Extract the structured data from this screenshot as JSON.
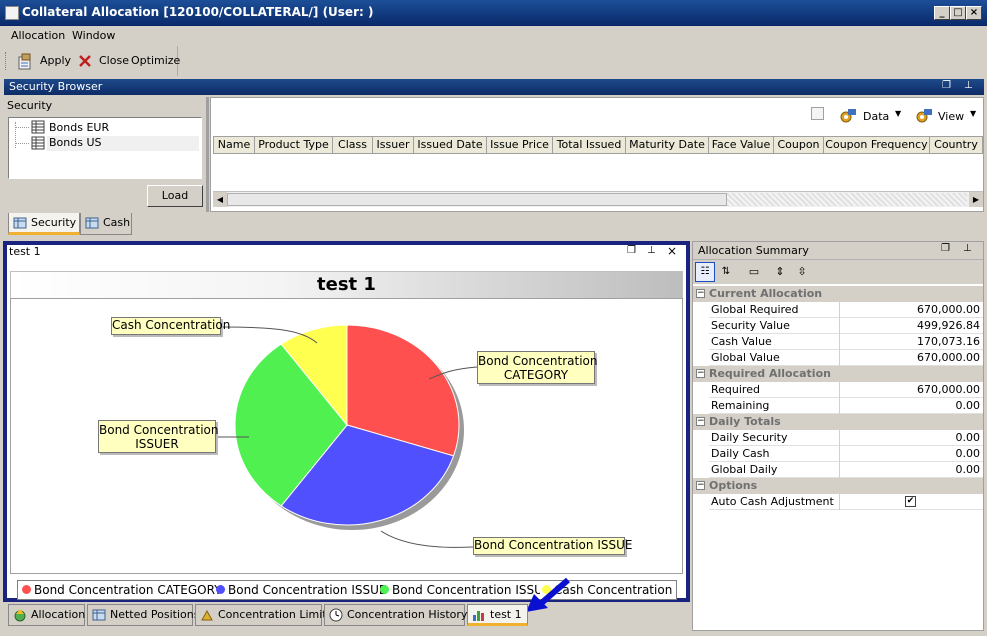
{
  "window": {
    "title": "Collateral Allocation [120100/COLLATERAL/] (User: )"
  },
  "menu": [
    "Allocation",
    "Window"
  ],
  "toolbar": {
    "apply": "Apply",
    "close": "Close",
    "optimize": "Optimize"
  },
  "security_browser": {
    "title": "Security Browser",
    "tree_header": "Security",
    "tree_items": [
      "Bonds EUR",
      "Bonds US"
    ],
    "load_button": "Load",
    "data_menu": "Data",
    "view_menu": "View",
    "columns": [
      "Name",
      "Product Type",
      "Class",
      "Issuer",
      "Issued Date",
      "Issue Price",
      "Total Issued",
      "Maturity Date",
      "Face Value",
      "Coupon",
      "Coupon Frequency",
      "Country"
    ],
    "tabs": [
      "Security",
      "Cash"
    ]
  },
  "chart_panel": {
    "tab_title": "test 1",
    "chart_data": {
      "type": "pie",
      "title": "test 1",
      "series": [
        {
          "name": "Bond Concentration CATEGORY",
          "value": 30,
          "color": "#ff5050"
        },
        {
          "name": "Bond Concentration ISSUE",
          "value": 30,
          "color": "#5050ff"
        },
        {
          "name": "Bond Concentration ISSUER",
          "value": 30,
          "color": "#50f050"
        },
        {
          "name": "Cash Concentration",
          "value": 10,
          "color": "#ffff50"
        }
      ],
      "callouts": {
        "cash": "Cash Concentration",
        "category_l1": "Bond Concentration",
        "category_l2": "CATEGORY",
        "issuer_l1": "Bond Concentration",
        "issuer_l2": "ISSUER",
        "issue": "Bond Concentration ISSUE"
      },
      "legend_placement": "bottom"
    }
  },
  "allocation_summary": {
    "title": "Allocation Summary",
    "sections": [
      {
        "name": "Current Allocation",
        "rows": [
          {
            "label": "Global Required",
            "value": "670,000.00"
          },
          {
            "label": "Security Value",
            "value": "499,926.84"
          },
          {
            "label": "Cash Value",
            "value": "170,073.16"
          },
          {
            "label": "Global Value",
            "value": "670,000.00"
          }
        ]
      },
      {
        "name": "Required Allocation",
        "rows": [
          {
            "label": "Required",
            "value": "670,000.00"
          },
          {
            "label": "Remaining",
            "value": "0.00"
          }
        ]
      },
      {
        "name": "Daily Totals",
        "rows": [
          {
            "label": "Daily Security",
            "value": "0.00"
          },
          {
            "label": "Daily Cash",
            "value": "0.00"
          },
          {
            "label": "Global Daily",
            "value": "0.00"
          }
        ]
      },
      {
        "name": "Options",
        "rows": [
          {
            "label": "Auto Cash Adjustment",
            "value": "✔"
          }
        ]
      }
    ]
  },
  "bottom_tabs": [
    "Allocation",
    "Netted Positions",
    "Concentration Limits",
    "Concentration History",
    "test 1"
  ]
}
